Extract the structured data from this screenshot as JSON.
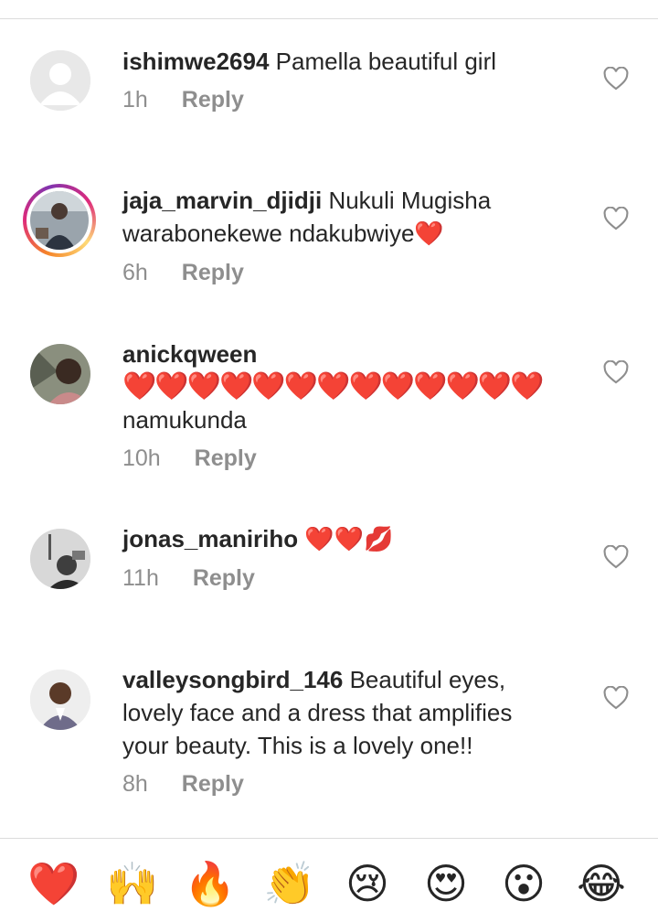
{
  "comments": [
    {
      "username": "ishimwe2694",
      "text": " Pamella beautiful girl",
      "time": "1h",
      "reply": "Reply"
    },
    {
      "username": "jaja_marvin_djidji",
      "text": " Nukuli Mugisha",
      "text2": "warabonekewe ndakubwiye❤️",
      "time": "6h",
      "reply": "Reply"
    },
    {
      "username": "anickqween",
      "hearts": "❤️❤️❤️❤️❤️❤️❤️❤️❤️❤️❤️❤️❤️",
      "text2": "namukunda",
      "time": "10h",
      "reply": "Reply"
    },
    {
      "username": "jonas_maniriho",
      "text": " ❤️❤️💋",
      "time": "11h",
      "reply": "Reply"
    },
    {
      "username": "valleysongbird_146",
      "text": " Beautiful eyes,",
      "text2": "lovely face and a dress that amplifies",
      "text3": "your beauty. This is a lovely one!!",
      "time": "8h",
      "reply": "Reply"
    }
  ],
  "reactions": [
    "❤️",
    "🙌",
    "🔥",
    "👏",
    "😢",
    "😍",
    "😮",
    "😂"
  ],
  "colors": {
    "like_outline": "#8e8e8e",
    "meta": "#8e8e8e",
    "text": "#262626",
    "heart": "#ed1c2e"
  }
}
